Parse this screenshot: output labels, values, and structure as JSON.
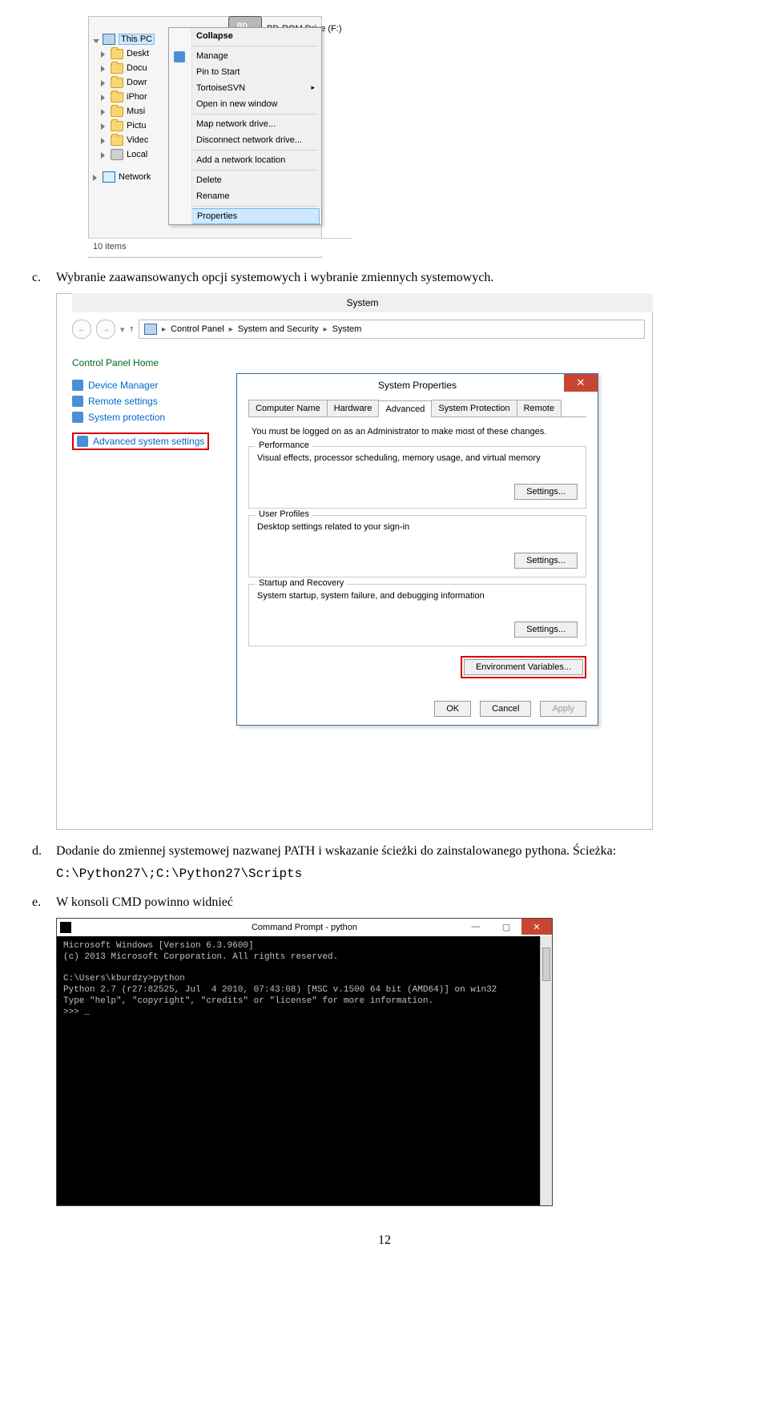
{
  "doc": {
    "c_marker": "c.",
    "c_text": "Wybranie zaawansowanych opcji systemowych i wybranie zmiennych systemowych.",
    "d_marker": "d.",
    "d_text1": "Dodanie do zmiennej systemowej nazwanej PATH i wskazanie ścieżki do zainstalowanego pythona. Ścieżka:",
    "d_path": "C:\\Python27\\;C:\\Python27\\Scripts",
    "e_marker": "e.",
    "e_text": "W konsoli CMD powinno widnieć",
    "page": "12"
  },
  "s1": {
    "bd_label": "BD-ROM Drive (F:)",
    "tree": {
      "this_pc": "This PC",
      "items": [
        "Deskt",
        "Docu",
        "Dowr",
        "iPhor",
        "Musi",
        "Pictu",
        "Videc",
        "Local"
      ],
      "network": "Network"
    },
    "footer": "10 items",
    "ctx": {
      "collapse": "Collapse",
      "manage": "Manage",
      "pin": "Pin to Start",
      "tortoise": "TortoiseSVN",
      "open_new": "Open in new window",
      "map": "Map network drive...",
      "disconnect": "Disconnect network drive...",
      "add_loc": "Add a network location",
      "delete": "Delete",
      "rename": "Rename",
      "properties": "Properties"
    }
  },
  "s2": {
    "title": "System",
    "breadcrumb": [
      "Control Panel",
      "System and Security",
      "System"
    ],
    "cpl_home": "Control Panel Home",
    "links": {
      "dev_mgr": "Device Manager",
      "remote": "Remote settings",
      "sys_prot": "System protection",
      "adv": "Advanced system settings"
    },
    "dlg": {
      "title": "System Properties",
      "tabs": [
        "Computer Name",
        "Hardware",
        "Advanced",
        "System Protection",
        "Remote"
      ],
      "admin_note": "You must be logged on as an Administrator to make most of these changes.",
      "perf": {
        "legend": "Performance",
        "desc": "Visual effects, processor scheduling, memory usage, and virtual memory",
        "btn": "Settings..."
      },
      "user": {
        "legend": "User Profiles",
        "desc": "Desktop settings related to your sign-in",
        "btn": "Settings..."
      },
      "startup": {
        "legend": "Startup and Recovery",
        "desc": "System startup, system failure, and debugging information",
        "btn": "Settings..."
      },
      "env_btn": "Environment Variables...",
      "ok": "OK",
      "cancel": "Cancel",
      "apply": "Apply"
    }
  },
  "s3": {
    "title": "Command Prompt - python",
    "lines": "Microsoft Windows [Version 6.3.9600]\n(c) 2013 Microsoft Corporation. All rights reserved.\n\nC:\\Users\\kburdzy>python\nPython 2.7 (r27:82525, Jul  4 2010, 07:43:08) [MSC v.1500 64 bit (AMD64)] on win32\nType \"help\", \"copyright\", \"credits\" or \"license\" for more information.\n>>> _"
  }
}
